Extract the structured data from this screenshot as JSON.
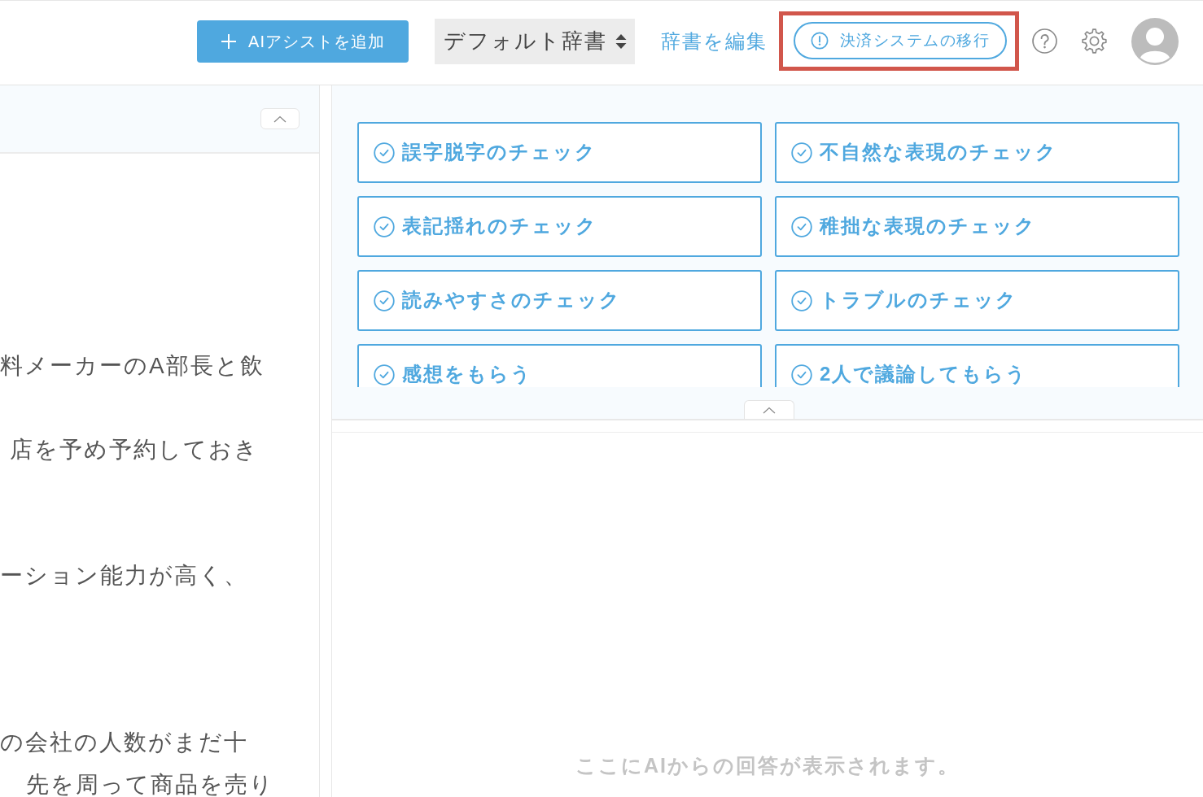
{
  "toolbar": {
    "add_button": {
      "label": "AIアシストを追加"
    },
    "dictionary_select": {
      "value": "デフォルト辞書"
    },
    "edit_dictionary_link": {
      "label": "辞書を編集"
    },
    "migration_button": {
      "label": "決済システムの移行",
      "highlighted": true
    }
  },
  "editor": {
    "lines": [
      "料メーカーのA部長と飲",
      "店を予め予約しておき",
      "ーション能力が高く、",
      "の会社の人数がまだ十",
      "先を周って商品を売り"
    ]
  },
  "assist_buttons": [
    {
      "label": "誤字脱字のチェック"
    },
    {
      "label": "不自然な表現のチェック"
    },
    {
      "label": "表記揺れのチェック"
    },
    {
      "label": "稚拙な表現のチェック"
    },
    {
      "label": "読みやすさのチェック"
    },
    {
      "label": "トラブルのチェック"
    },
    {
      "label": "感想をもらう"
    },
    {
      "label": "2人で議論してもらう"
    }
  ],
  "response": {
    "empty_message": "ここにAIからの回答が表示されます。"
  }
}
